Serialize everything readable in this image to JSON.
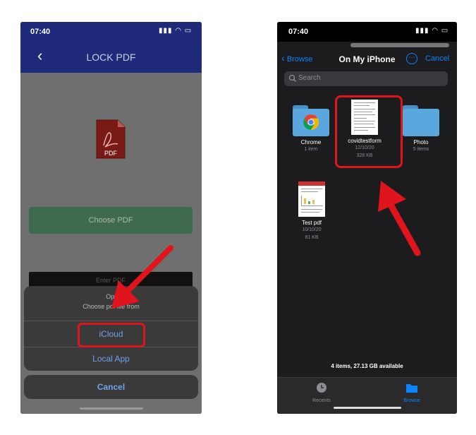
{
  "left_screen": {
    "status_time": "07:40",
    "header_title": "LOCK PDF",
    "pdf_icon_text": "PDF",
    "choose_button": "Choose PDF",
    "enter_field_partial": "Enter PDF",
    "sheet": {
      "title": "Opt",
      "subtitle": "Choose pdf file from",
      "options": [
        "iCloud",
        "Local App"
      ],
      "cancel": "Cancel"
    }
  },
  "right_screen": {
    "status_time": "07:40",
    "nav": {
      "back": "Browse",
      "title": "On My iPhone",
      "cancel": "Cancel"
    },
    "search_placeholder": "Search",
    "files": [
      {
        "name": "Chrome",
        "meta1": "1 item",
        "meta2": ""
      },
      {
        "name": "covidtestform",
        "meta1": "12/10/20",
        "meta2": "328 KB"
      },
      {
        "name": "Photo",
        "meta1": "5 items",
        "meta2": ""
      },
      {
        "name": "Test pdf",
        "meta1": "10/10/20",
        "meta2": "81 KB"
      }
    ],
    "footer": "4 items, 27.13 GB available",
    "tabs": [
      "Recents",
      "Browse"
    ]
  },
  "colors": {
    "highlight": "#e0141c",
    "ios_blue": "#0a84ff",
    "header_navy": "#1f2a7a"
  }
}
